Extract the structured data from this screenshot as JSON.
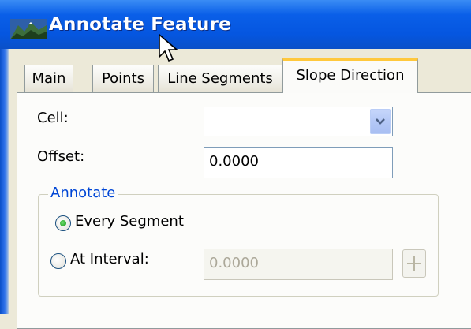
{
  "window": {
    "title": "Annotate Feature"
  },
  "tabs": [
    {
      "label": "Main",
      "active": false
    },
    {
      "label": "Points",
      "active": false
    },
    {
      "label": "Line Segments",
      "active": false
    },
    {
      "label": "Slope Direction",
      "active": true
    }
  ],
  "form": {
    "cell_label": "Cell:",
    "cell_value": "",
    "offset_label": "Offset:",
    "offset_value": "0.0000",
    "annotate_group": {
      "legend": "Annotate",
      "every_segment_label": "Every Segment",
      "every_segment_selected": true,
      "at_interval_label": "At Interval:",
      "at_interval_selected": false,
      "interval_value": "0.0000"
    }
  },
  "colors": {
    "titlebar": "#0556e0",
    "active_tab_accent": "#ffc83c",
    "group_legend": "#0046d5",
    "radio_selected": "#21a121"
  }
}
